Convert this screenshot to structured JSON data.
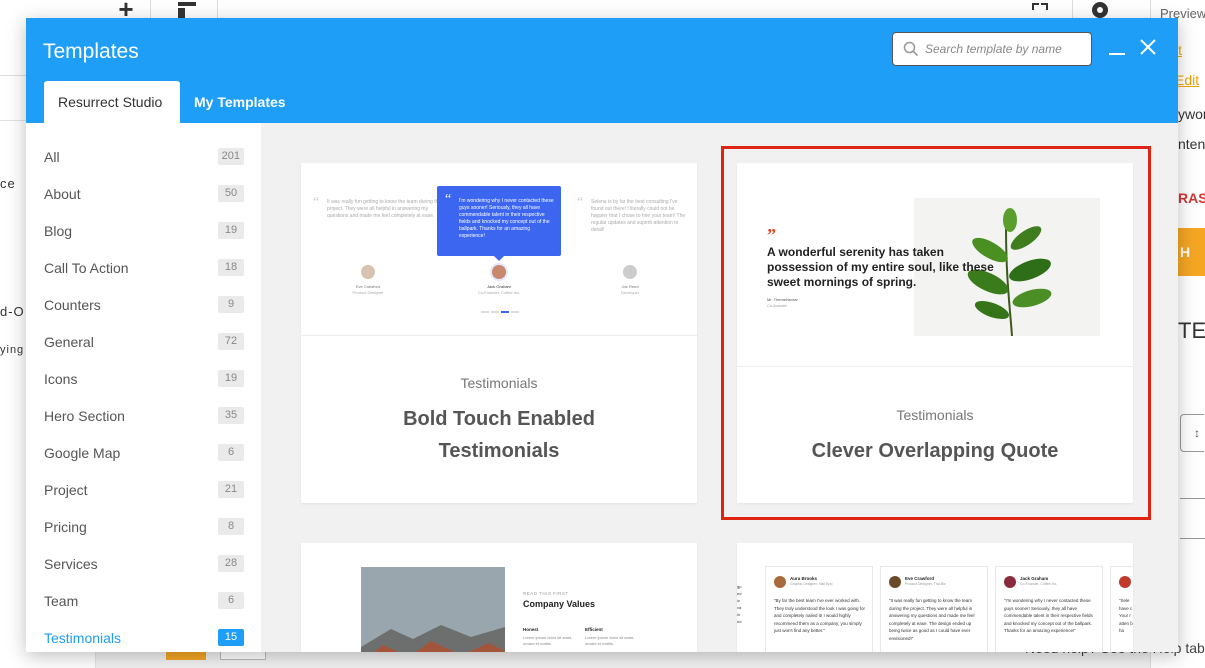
{
  "background": {
    "preview_label": "Preview",
    "links": [
      "it",
      "Edit"
    ],
    "side_words": [
      "ywor",
      "nten"
    ],
    "red_text": "RASI",
    "orange_button": "H",
    "big_text": "TE",
    "left_words": [
      "ce",
      "d-O",
      "ying"
    ],
    "help_text": "Need help? See the Help tab a"
  },
  "modal": {
    "title": "Templates",
    "search": {
      "placeholder": "Search template by name",
      "value": ""
    },
    "tabs": [
      {
        "label": "Resurrect Studio",
        "active": true
      },
      {
        "label": "My Templates",
        "active": false
      }
    ]
  },
  "sidebar": {
    "categories": [
      {
        "label": "All",
        "count": "201"
      },
      {
        "label": "About",
        "count": "50"
      },
      {
        "label": "Blog",
        "count": "19"
      },
      {
        "label": "Call To Action",
        "count": "18"
      },
      {
        "label": "Counters",
        "count": "9"
      },
      {
        "label": "General",
        "count": "72"
      },
      {
        "label": "Icons",
        "count": "19"
      },
      {
        "label": "Hero Section",
        "count": "35"
      },
      {
        "label": "Google Map",
        "count": "6"
      },
      {
        "label": "Project",
        "count": "21"
      },
      {
        "label": "Pricing",
        "count": "8"
      },
      {
        "label": "Services",
        "count": "28"
      },
      {
        "label": "Team",
        "count": "6"
      },
      {
        "label": "Testimonials",
        "count": "15",
        "active": true
      }
    ]
  },
  "templates": [
    {
      "category": "Testimonials",
      "title": "Bold Touch Enabled Testimonials",
      "preview": {
        "left_quote": "It was really fun getting to know the team during the project. They were all helpful in answering my questions and made me feel completely at ease.",
        "center_quote": "I'm wondering why I never contacted these guys sooner! Seriously, they all have commendable talent in their respective fields and knocked my concept out of the ballpark. Thanks for an amazing experience!",
        "right_quote": "Selena is by far the best consulting I've found out there! I literally could not be happier that I chose to hire your team! The regular updates and superb attention to detail!",
        "names": [
          "Eve Crawford",
          "Jack Graham",
          "Joe Reed"
        ],
        "roles": [
          "Product Designer",
          "Co-Founder, Coffee Inc.",
          "Developer"
        ]
      }
    },
    {
      "category": "Testimonials",
      "title": "Clever Overlapping Quote",
      "selected": true,
      "preview": {
        "quote_mark": "”",
        "quote": "A wonderful serenity has taken possession of my entire soul, like these sweet mornings of spring.",
        "author": "Mr. ThemeNectar",
        "author_role": "Co-founder"
      }
    },
    {
      "preview": {
        "eyebrow": "READ THIS FIRST",
        "heading": "Company Values",
        "col1_title": "Honest",
        "col2_title": "Efficient",
        "col_text": "Lorem ipsum dolor sit amet, ornare et mattis."
      }
    },
    {
      "preview": {
        "cards": [
          {
            "name": "Aura Brooks",
            "role": "Graphic Designer, Nail Epic",
            "text": "“By far the best team I've ever worked with. They truly understood the look I was going for and completely nailed it! I would highly recommend them as a company, you simply just won't find any better.”",
            "color": "#a86a3a"
          },
          {
            "name": "Eve Crawford",
            "role": "Product Designer, Tha Biz",
            "text": "“It was really fun getting to know the team during the project. They were all helpful in answering my questions and made me feel completely at ease. The design ended up being twice as good as I could have ever envisioned!”",
            "color": "#6b4a2a"
          },
          {
            "name": "Jack Graham",
            "role": "Co-Founder, Coffee Inc.",
            "text": "“I'm wondering why I never contacted these guys sooner! Seriously, they all have commendable talent in their respective fields and knocked my concept out of the ballpark. Thanks for an amazing experience!”",
            "color": "#8a2a3a"
          }
        ],
        "edge_text": "“Sele have c Your r atten be ha"
      }
    }
  ],
  "colors": {
    "header": "#1e9ef6",
    "selected_border": "#e02414",
    "active_count": "#1e9ef6",
    "quote_mark": "#e0421c",
    "mini_highlight": "#3c66f0"
  }
}
